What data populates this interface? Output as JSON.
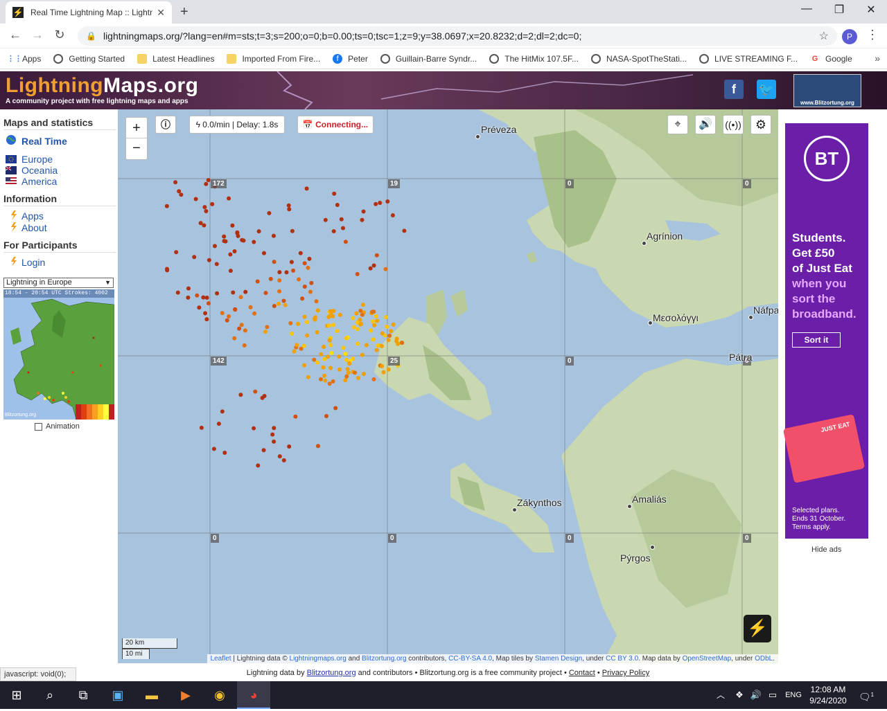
{
  "browser": {
    "tab_title": "Real Time Lightning Map :: Lightn",
    "url": "lightningmaps.org/?lang=en#m=sts;t=3;s=200;o=0;b=0.00;ts=0;tsc=1;z=9;y=38.0697;x=20.8232;d=2;dl=2;dc=0;",
    "profile_initial": "P",
    "bookmarks": [
      "Apps",
      "Getting Started",
      "Latest Headlines",
      "Imported From Fire...",
      "Peter",
      "Guillain-Barre Syndr...",
      "The HitMix 107.5F...",
      "NASA-SpotTheStati...",
      "LIVE STREAMING F...",
      "Google"
    ]
  },
  "site": {
    "logo_part1": "Lightning",
    "logo_part2": "Maps.org",
    "tagline": "A community project with free lightning maps and apps",
    "blitz_logo": "www.Blitzortung.org"
  },
  "sidebar": {
    "maps_heading": "Maps and statistics",
    "realtime": "Real Time",
    "regions": [
      "Europe",
      "Oceania",
      "America"
    ],
    "info_heading": "Information",
    "info_links": [
      "Apps",
      "About"
    ],
    "participants_heading": "For Participants",
    "login": "Login",
    "select_value": "Lightning in Europe",
    "minimap_header": "18:54 - 20:54 UTC Strokes: 4002",
    "minimap_credit": "Blitzortung.org",
    "animation_label": "Animation"
  },
  "map": {
    "zoom_in": "+",
    "zoom_out": "−",
    "rate": "0.0/min | Delay: 1.8s",
    "connecting": "Connecting...",
    "grid_labels": [
      "172",
      "19",
      "0",
      "0",
      "142",
      "25",
      "0",
      "0",
      "0",
      "0",
      "0",
      "0"
    ],
    "places": [
      "Préveza",
      "Agrínion",
      "Μεσολόγγι",
      "Náfpa",
      "Pátra",
      "Zákynthos",
      "Amaliás",
      "Pýrgos"
    ],
    "scale_km": "20 km",
    "scale_mi": "10 mi",
    "attribution": {
      "leaflet": "Leaflet",
      "t1": " | Lightning data © ",
      "l1": "Lightningmaps.org",
      "t2": " and ",
      "l2": "Blitzortung.org",
      "t3": " contributors, ",
      "l3": "CC-BY-SA 4.0",
      "t4": ", Map tiles by ",
      "l4": "Stamen Design",
      "t5": ", under ",
      "l5": "CC BY 3.0",
      "t6": ". Map data by ",
      "l6": "OpenStreetMap",
      "t7": ", under ",
      "l7": "ODbL",
      "t8": "."
    }
  },
  "ad": {
    "brand": "BT",
    "line1": "Students.",
    "line2": "Get £50",
    "line3": "of Just Eat",
    "line4": "when you",
    "line5": "sort the",
    "line6": "broadband.",
    "cta": "Sort it",
    "card_label": "JUST EAT",
    "fine1": "Selected plans.",
    "fine2": "Ends 31 October.",
    "fine3": "Terms apply.",
    "hide": "Hide ads"
  },
  "footer": {
    "status": "javascript: void(0);",
    "t1": "Lightning data by ",
    "l1": "Blitzortung.org",
    "t2": " and contributors • Blitzortung.org is a free community project • ",
    "l2": "Contact",
    "t3": " • ",
    "l3": "Privacy Policy"
  },
  "taskbar": {
    "lang": "ENG",
    "time": "12:08 AM",
    "date": "9/24/2020",
    "notif": "1"
  }
}
